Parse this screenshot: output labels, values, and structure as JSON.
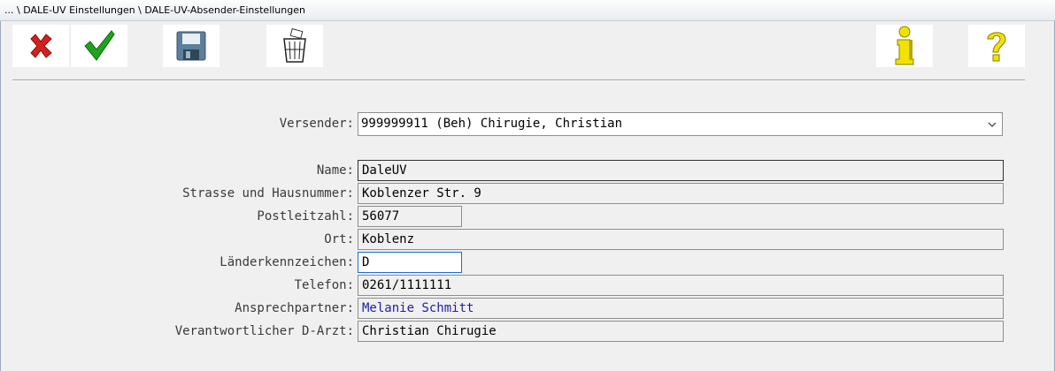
{
  "window": {
    "title": "... \\ DALE-UV Einstellungen \\ DALE-UV-Absender-Einstellungen"
  },
  "toolbar": {
    "cancel_icon": "red-x-icon",
    "ok_icon": "green-check-icon",
    "save_icon": "floppy-disk-icon",
    "delete_icon": "trash-can-icon",
    "info_icon": "info-i-icon",
    "help_icon": "question-mark-icon"
  },
  "form": {
    "versender": {
      "label": "Versender:",
      "value": "999999911 (Beh) Chirugie, Christian"
    },
    "name": {
      "label": "Name:",
      "value": "DaleUV"
    },
    "strasse": {
      "label": "Strasse und Hausnummer:",
      "value": "Koblenzer Str. 9"
    },
    "plz": {
      "label": "Postleitzahl:",
      "value": "56077"
    },
    "ort": {
      "label": "Ort:",
      "value": "Koblenz"
    },
    "laender": {
      "label": "Länderkennzeichen:",
      "value": "D"
    },
    "telefon": {
      "label": "Telefon:",
      "value": "0261/1111111"
    },
    "ansprech": {
      "label": "Ansprechpartner:",
      "value": "Melanie Schmitt"
    },
    "arzt": {
      "label": "Verantwortlicher D-Arzt:",
      "value": "Christian Chirugie"
    }
  },
  "colors": {
    "accent_focus": "#1e6fd0",
    "link_text": "#2020a8",
    "cancel_red": "#d42020",
    "ok_green": "#1fa31f",
    "info_yellow": "#f2e200"
  }
}
